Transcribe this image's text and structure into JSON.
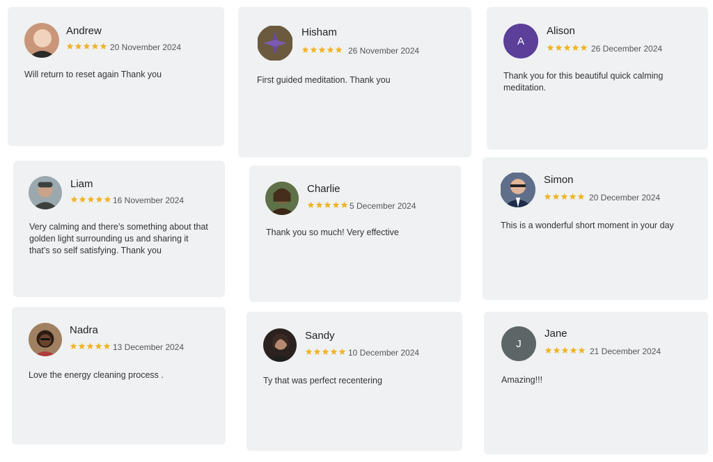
{
  "reviews": [
    {
      "name": "Andrew",
      "date": "20 November 2024",
      "text": "Will return to reset again Thank you",
      "rating": 5,
      "avatar": {
        "type": "photo",
        "bg": "#c9967a",
        "fg": "#f1d2bd"
      }
    },
    {
      "name": "Hisham",
      "date": "26 November 2024",
      "text": "First guided meditation. Thank you",
      "rating": 5,
      "avatar": {
        "type": "photo",
        "bg": "#6b5a3d",
        "fg": "#6a4a9c"
      }
    },
    {
      "name": "Alison",
      "date": "26 December 2024",
      "text": "Thank you for this beautiful quick calming meditation.",
      "rating": 5,
      "avatar": {
        "type": "initial",
        "letter": "A",
        "bg": "#5b3f98"
      }
    },
    {
      "name": "Liam",
      "date": "16 November 2024",
      "text": "Very calming and there’s something about that golden light surrounding us and sharing it that’s so self satisfying. Thank you",
      "rating": 5,
      "avatar": {
        "type": "photo",
        "bg": "#9ba8ad",
        "fg": "#3c4140"
      }
    },
    {
      "name": "Charlie",
      "date": "5 December 2024",
      "text": "Thank you so much! Very effective",
      "rating": 5,
      "avatar": {
        "type": "photo",
        "bg": "#5f7148",
        "fg": "#3a2616"
      }
    },
    {
      "name": "Simon",
      "date": "20 December 2024",
      "text": "This is a wonderful short moment in your day",
      "rating": 5,
      "avatar": {
        "type": "photo",
        "bg": "#5f6f8a",
        "fg": "#1e2b4a"
      }
    },
    {
      "name": "Nadra",
      "date": "13 December 2024",
      "text": "Love the energy cleaning process .",
      "rating": 5,
      "avatar": {
        "type": "photo",
        "bg": "#a08060",
        "fg": "#2b1c14"
      }
    },
    {
      "name": "Sandy",
      "date": "10 December 2024",
      "text": "Ty that was perfect recentering",
      "rating": 5,
      "avatar": {
        "type": "photo",
        "bg": "#2b2220",
        "fg": "#b88870"
      }
    },
    {
      "name": "Jane",
      "date": "21 December 2024",
      "text": "Amazing!!!",
      "rating": 5,
      "avatar": {
        "type": "initial",
        "letter": "J",
        "bg": "#5d6567"
      }
    }
  ],
  "colors": {
    "card_bg": "#eff1f2",
    "star": "#f0b429"
  }
}
